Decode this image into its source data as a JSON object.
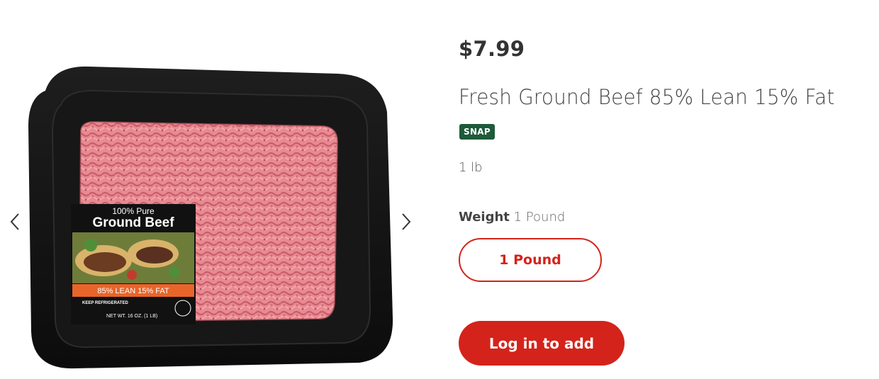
{
  "gallery": {
    "prev_icon": "chevron-left-icon",
    "next_icon": "chevron-right-icon",
    "image": {
      "label_line1": "100% Pure",
      "label_line2": "Ground Beef",
      "label_banner": "85% LEAN 15% FAT",
      "label_note": "KEEP REFRIGERATED",
      "label_weight": "NET WT. 16 OZ. (1 LB)"
    }
  },
  "product": {
    "price": "$7.99",
    "title": "Fresh Ground Beef 85% Lean 15% Fat",
    "badge": "SNAP",
    "size": "1 lb",
    "weight_label": "Weight",
    "weight_value": "1 Pound",
    "variant_option": "1 Pound",
    "add_button": "Log in to add"
  },
  "colors": {
    "accent": "#d4231b",
    "badge_bg": "#1f5a3a",
    "text": "#333333"
  }
}
